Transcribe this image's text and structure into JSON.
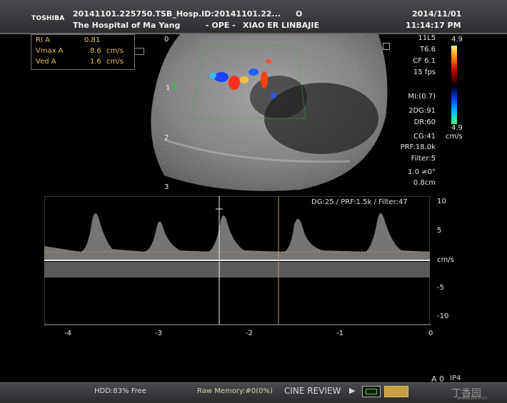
{
  "header": {
    "brand": "TOSHIBA",
    "study_id": "20141101.225750.TSB_Hosp.ID:20141101.22...",
    "marker": "O",
    "date": "2014/11/01",
    "hospital": "The Hospital of Ma Yang",
    "department": "- OPE -",
    "patient": "XIAO ER LINBAJIE",
    "time": "11:14:17 PM"
  },
  "measurements": [
    {
      "label": "RI  A",
      "value": "0.81",
      "unit": ""
    },
    {
      "label": "Vmax  A",
      "value": "8.6",
      "unit": "cm/s"
    },
    {
      "label": "Ved  A",
      "value": "1.6",
      "unit": "cm/s"
    }
  ],
  "params_top": [
    "11L5",
    "T6.6",
    "CF 6.1",
    "15 fps"
  ],
  "params_mid": [
    "MI:(0.7)",
    "2DG:91",
    "DR:60",
    "CG:41",
    "PRF:18.0k",
    "Filter:5",
    "1.0  ≠0°",
    "0.8cm"
  ],
  "color_scale": {
    "top": "4.9",
    "bottom": "4.9",
    "unit": "cm/s"
  },
  "depth_marks": [
    "0",
    "1",
    "2",
    "3"
  ],
  "doppler": {
    "settings": "DG:25 /   PRF:1.5k   / Filter:47",
    "v_ticks": [
      "10",
      "5",
      "cm/s",
      "-5",
      "-10"
    ],
    "t_ticks": [
      "-4",
      "-3",
      "-2",
      "-1",
      "0"
    ]
  },
  "footer": {
    "hdd": "HDD:83% Free",
    "raw_memory": "Raw Memory:#0(0%)",
    "cine_review": "CINE REVIEW",
    "play_icon": "play-icon",
    "a_label": "A 0",
    "ip_label": "IP4",
    "watermark": "丁香园",
    "watermark_url": "www.DXY.cn"
  }
}
